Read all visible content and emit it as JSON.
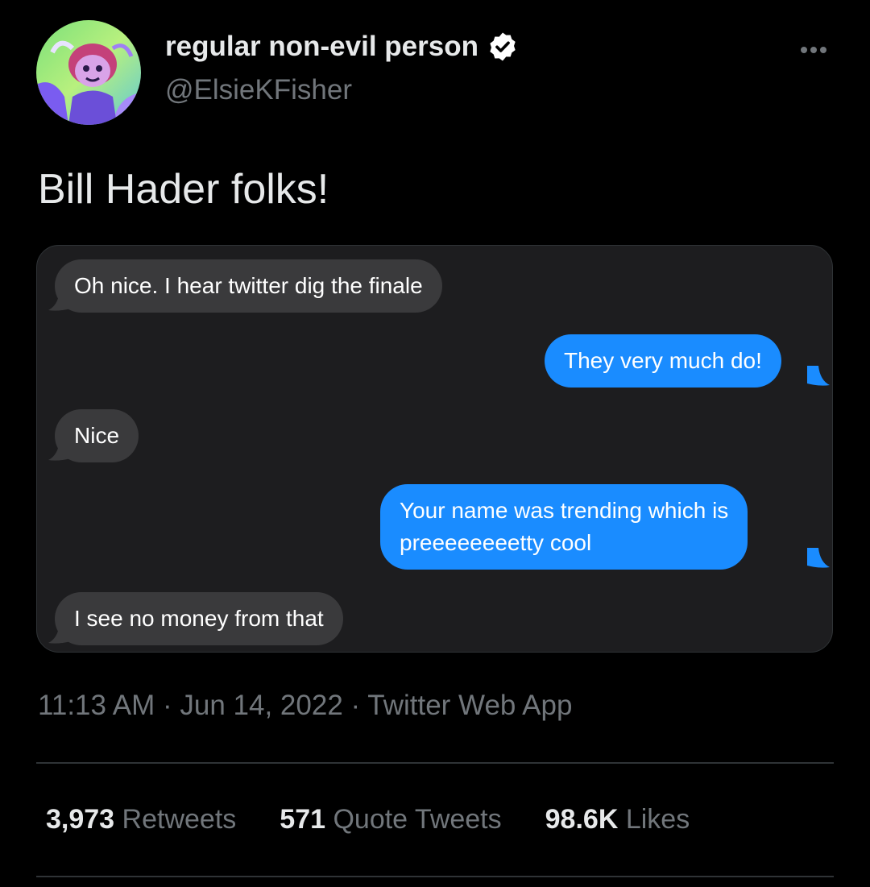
{
  "author": {
    "display_name": "regular non-evil person",
    "handle": "@ElsieKFisher",
    "verified_icon": "verified-badge-icon",
    "avatar_icon": "avatar-image"
  },
  "tweet": {
    "text": "Bill Hader folks!",
    "timestamp": "11:13 AM · Jun 14, 2022 · Twitter Web App"
  },
  "screenshot_messages": [
    {
      "side": "received",
      "text": "Oh nice. I hear twitter dig the finale"
    },
    {
      "side": "sent",
      "text": "They very much do!"
    },
    {
      "side": "received",
      "text": "Nice"
    },
    {
      "side": "sent",
      "text_lines": [
        "Your name was trending which is",
        "preeeeeeeetty cool"
      ]
    },
    {
      "side": "received",
      "text": "I see no money from that"
    }
  ],
  "stats": [
    {
      "count": "3,973",
      "label": "Retweets"
    },
    {
      "count": "571",
      "label": "Quote Tweets"
    },
    {
      "count": "98.6K",
      "label": "Likes"
    }
  ],
  "colors": {
    "background": "#000000",
    "sent_bubble": "#1a8cff",
    "received_bubble": "#3a3a3c",
    "muted_text": "#71767b",
    "verified": "#ffffff"
  }
}
